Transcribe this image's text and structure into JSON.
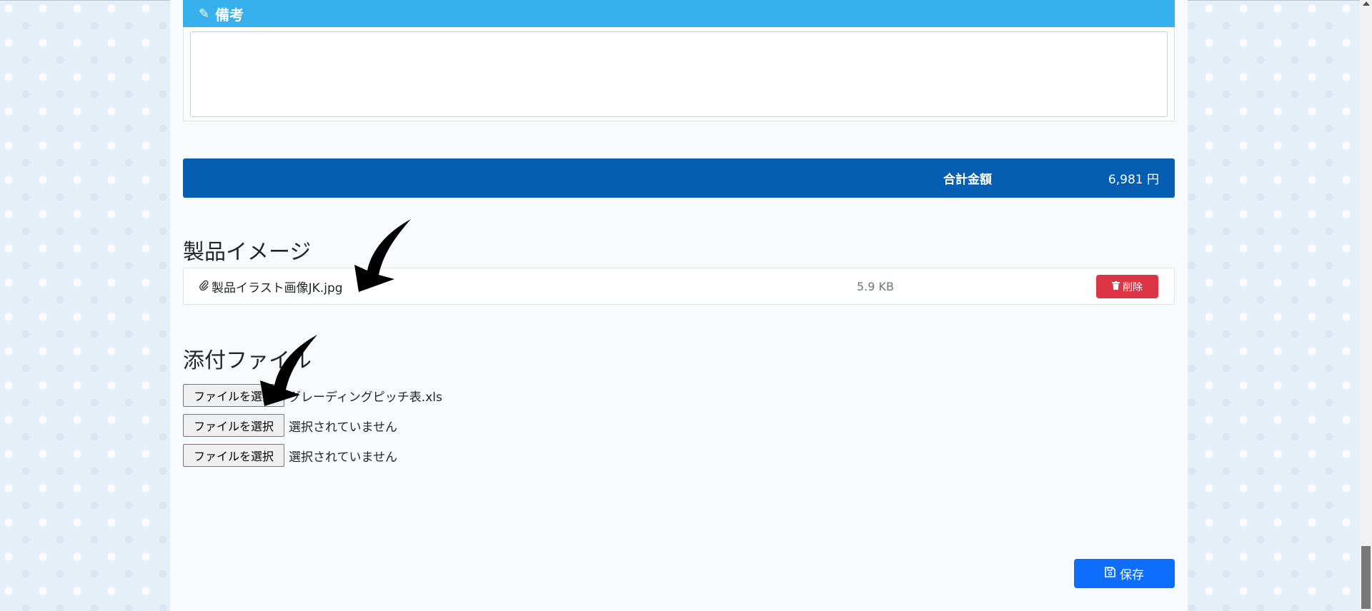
{
  "remarks": {
    "title": "備考",
    "icon": "pencil-icon",
    "textarea_value": ""
  },
  "total": {
    "label": "合計金額",
    "value": "6,981 円"
  },
  "product_image": {
    "title": "製品イメージ",
    "file": {
      "icon": "paperclip-icon",
      "name": "製品イラスト画像JK.jpg",
      "size": "5.9 KB"
    },
    "delete_label": "削除",
    "delete_icon": "trash-icon"
  },
  "attachments": {
    "title": "添付ファイル",
    "inputs": [
      {
        "button_label": "ファイルを選択",
        "status": "グレーディングピッチ表.xls"
      },
      {
        "button_label": "ファイルを選択",
        "status": "選択されていません"
      },
      {
        "button_label": "ファイルを選択",
        "status": "選択されていません"
      }
    ]
  },
  "save": {
    "label": "保存",
    "icon": "floppy-disk-icon"
  },
  "colors": {
    "remarks_header": "#36b1ee",
    "total_bar": "#065eb2",
    "delete_button": "#dc3545",
    "save_button": "#0d6efd"
  }
}
